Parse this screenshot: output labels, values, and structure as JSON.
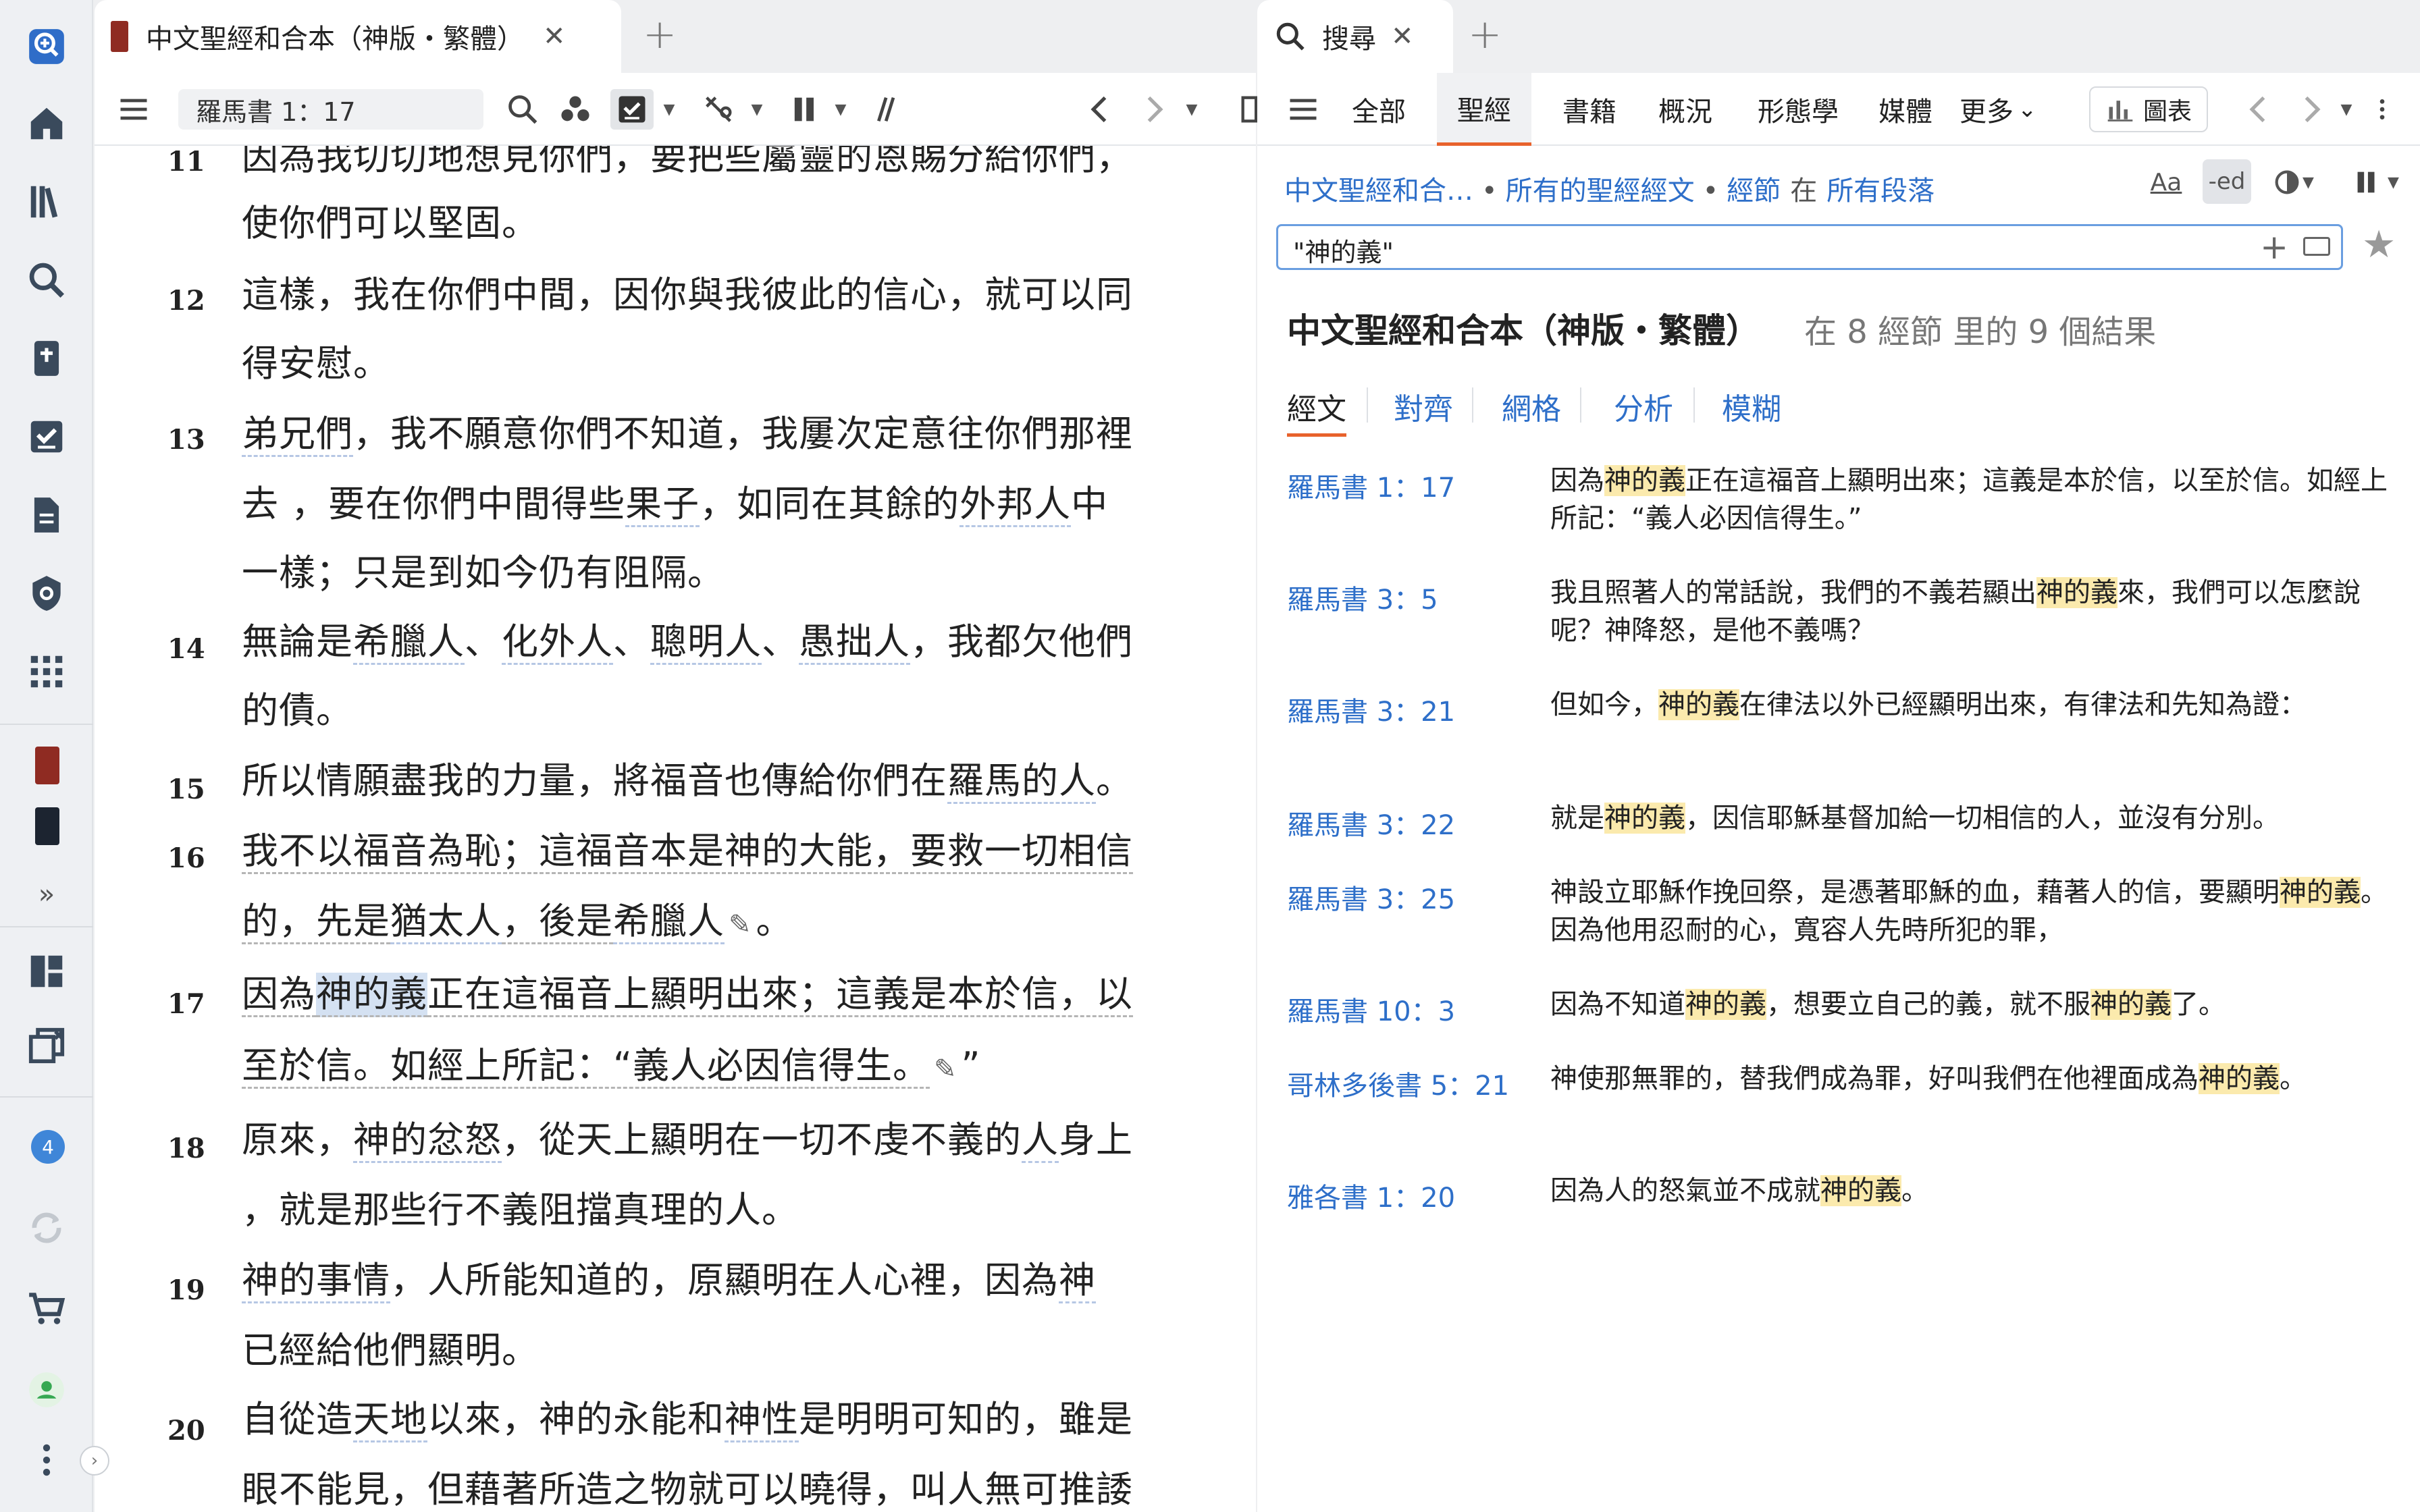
{
  "left_panel": {
    "tab_title": "中文聖經和合本（神版・繁體）",
    "tab_close": "✕",
    "tab_add": "+",
    "reference": "羅馬書 1：17",
    "verses": [
      {
        "num": "11",
        "lines": [
          [
            "因為我切切地想見你們，要把些屬靈的恩賜分給你們，"
          ],
          [
            "使你們可以堅固。"
          ]
        ]
      },
      {
        "num": "12",
        "lines": [
          [
            "這樣，我在你們中間，因你與我彼此的信心，就可以同"
          ],
          [
            "得安慰。"
          ]
        ]
      },
      {
        "num": "13",
        "lines": [
          [
            "弟兄們",
            "，我不願意你們不知道，我屢次定意往你們那裡"
          ],
          [
            "去 ，要在你們中間得些",
            "果子",
            "，如同在其餘的",
            "外邦人",
            "中"
          ],
          [
            "一樣；只是到如今仍有阻隔。"
          ]
        ]
      },
      {
        "num": "14",
        "lines": [
          [
            "無論是",
            "希臘人",
            "、",
            "化外人",
            "、",
            "聰明人",
            "、",
            "愚拙人",
            "，我都欠他們"
          ],
          [
            "的債。"
          ]
        ]
      },
      {
        "num": "15",
        "lines": [
          [
            "所以情願盡我的力量，將福音也傳給你們在",
            "羅馬的人",
            "。"
          ]
        ]
      },
      {
        "num": "16",
        "lines": [
          [
            "我不以福音為恥；這福音本是神的大能，要救一切相信"
          ],
          [
            "的，先是",
            "猶太人",
            "，後是",
            "希臘人",
            "。"
          ]
        ]
      },
      {
        "num": "17",
        "lines": [
          [
            "因為",
            "神的義",
            "正在這福音上顯明出來；這義是本於信，以"
          ],
          [
            "至於信。如經上所記：“義人必因信得生。",
            "”"
          ]
        ]
      },
      {
        "num": "18",
        "lines": [
          [
            "原來，",
            "神的忿怒",
            "，從天上顯明在一切不虔不義的",
            "人",
            "身上"
          ],
          [
            "，就是那些行不義阻擋真理的人。"
          ]
        ]
      },
      {
        "num": "19",
        "lines": [
          [
            "神的事情",
            "，人所能知道的，原顯明在人心裡，因為",
            "神"
          ],
          [
            "已經給他們顯明。"
          ]
        ]
      },
      {
        "num": "20",
        "lines": [
          [
            "自從造",
            "天地",
            "以來，神的永能和",
            "神性",
            "是明明可知的，雖是"
          ],
          [
            "眼不能見，但藉著所造之物就可以曉得，叫人無可推諉"
          ]
        ]
      }
    ]
  },
  "right_panel": {
    "tab_title": "搜尋",
    "tab_close": "✕",
    "tab_add": "+",
    "nav_tabs": [
      "全部",
      "聖經",
      "書籍",
      "概況",
      "形態學",
      "媒體",
      "更多"
    ],
    "more_caret": "⌄",
    "chart_label": "圖表",
    "crumbs": {
      "bible": "中文聖經和合…",
      "scope": "所有的聖經經文",
      "unit": "經節",
      "word_in": "在",
      "paragraphs": "所有段落",
      "dot": "•"
    },
    "case_label": "Aa",
    "ed_label": "-ed",
    "search_query": "\"神的義\"",
    "result_title": "中文聖經和合本（神版・繁體）",
    "result_count": "在 8 經節 里的 9 個結果",
    "sub_tabs": [
      "經文",
      "對齊",
      "網格",
      "分析",
      "模糊"
    ],
    "results": [
      {
        "ref": "羅馬書 1：17",
        "parts": [
          "因為",
          "神的義",
          "正在這福音上顯明出來；這義是本於信，以至於信。如經上所記：“義人必因信得生。”"
        ]
      },
      {
        "ref": "羅馬書 3：5",
        "parts": [
          "我且照著人的常話說，我們的不義若顯出",
          "神的義",
          "來，我們可以怎麼說呢？神降怒，是他不義嗎？"
        ]
      },
      {
        "ref": "羅馬書 3：21",
        "parts": [
          "但如今，",
          "神的義",
          "在律法以外已經顯明出來，有律法和先知為證："
        ]
      },
      {
        "ref": "羅馬書 3：22",
        "parts": [
          "就是",
          "神的義",
          "，因信耶穌基督加給一切相信的人，並沒有分別。"
        ]
      },
      {
        "ref": "羅馬書 3：25",
        "parts": [
          "神設立耶穌作挽回祭，是憑著耶穌的血，藉著人的信，要顯明",
          "神的義",
          "。因為他用忍耐的心，寬容人先時所犯的罪，"
        ]
      },
      {
        "ref": "羅馬書 10：3",
        "parts": [
          "因為不知道",
          "神的義",
          "，想要立自己的義，就不服",
          "神的義",
          "了。"
        ]
      },
      {
        "ref": "哥林多後書 5：21",
        "parts": [
          "神使那無罪的，替我們成為罪，好叫我們在他裡面成為",
          "神的義",
          "。"
        ]
      },
      {
        "ref": "雅各書 1：20",
        "parts": [
          "因為人的怒氣並不成就",
          "神的義",
          "。"
        ]
      }
    ]
  },
  "rail": {
    "more_label": "»",
    "notification_count": "4",
    "collapse_label": "›"
  },
  "colors": {
    "accent_orange": "#e8622c",
    "link_blue": "#2e6fc9",
    "highlight_yellow": "#fbeaad",
    "selection_blue": "#d4e1f2"
  }
}
